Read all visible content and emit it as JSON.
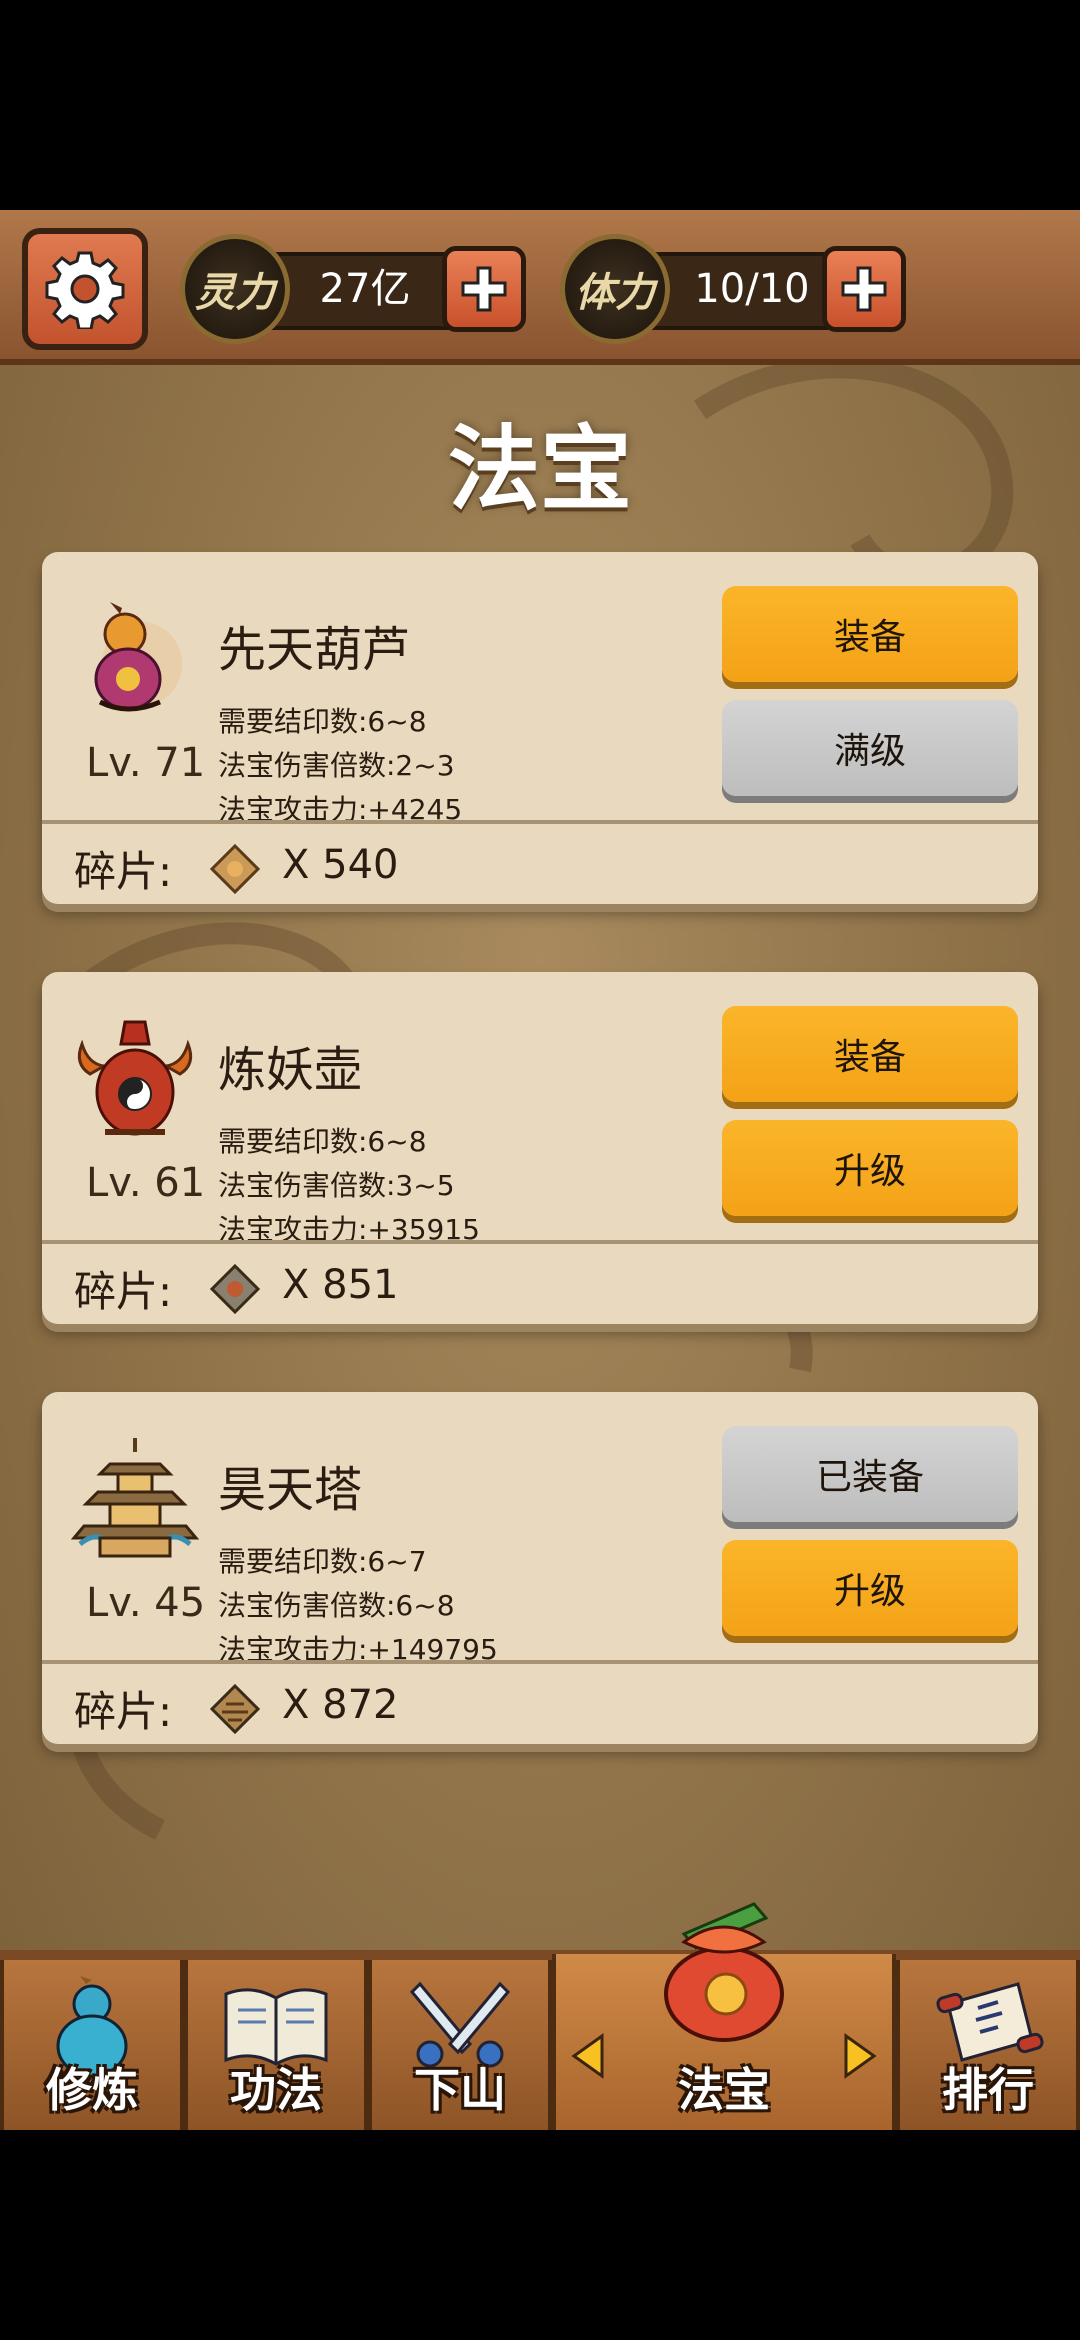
{
  "header": {
    "resources": [
      {
        "name": "灵力",
        "value": "27亿"
      },
      {
        "name": "体力",
        "value": "10/10"
      }
    ]
  },
  "page_title": "法宝",
  "items": [
    {
      "name": "先天葫芦",
      "level": "Lv. 71",
      "stats": [
        "需要结印数:6~8",
        "法宝伤害倍数:2~3",
        "法宝攻击力:+4245"
      ],
      "buttons": [
        "装备",
        "满级"
      ],
      "fragment_label": "碎片:",
      "fragment_count": "X  540"
    },
    {
      "name": "炼妖壶",
      "level": "Lv. 61",
      "stats": [
        "需要结印数:6~8",
        "法宝伤害倍数:3~5",
        "法宝攻击力:+35915"
      ],
      "buttons": [
        "装备",
        "升级"
      ],
      "fragment_label": "碎片:",
      "fragment_count": "X  851"
    },
    {
      "name": "昊天塔",
      "level": "Lv. 45",
      "stats": [
        "需要结印数:6~7",
        "法宝伤害倍数:6~8",
        "法宝攻击力:+149795"
      ],
      "buttons": [
        "已装备",
        "升级"
      ],
      "fragment_label": "碎片:",
      "fragment_count": "X  872"
    }
  ],
  "nav": [
    {
      "label": "修炼",
      "icon": "gourd-icon"
    },
    {
      "label": "功法",
      "icon": "book-icon"
    },
    {
      "label": "下山",
      "icon": "swords-icon"
    },
    {
      "label": "法宝",
      "icon": "treasure-bag-icon",
      "active": true
    },
    {
      "label": "排行",
      "icon": "scroll-icon"
    }
  ],
  "colors": {
    "gold_button": "#f4a216",
    "grey_button": "#bdbdbd",
    "card": "#e8d9bf",
    "topbar": "#8a5430"
  }
}
